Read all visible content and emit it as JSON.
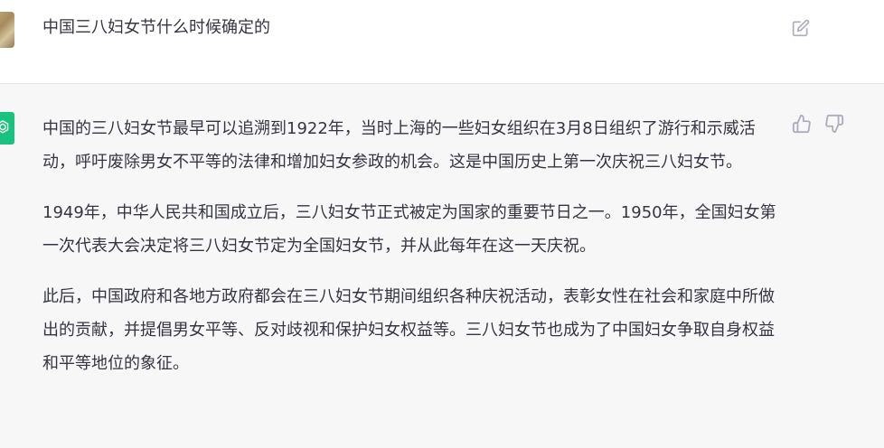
{
  "user_message": {
    "text": "中国三八妇女节什么时候确定的",
    "avatar_icon": "user-photo",
    "edit_icon": "edit-icon"
  },
  "assistant_message": {
    "avatar_icon": "openai-logo",
    "avatar_color": "#19c37d",
    "paragraphs": [
      "中国的三八妇女节最早可以追溯到1922年，当时上海的一些妇女组织在3月8日组织了游行和示威活动，呼吁废除男女不平等的法律和增加妇女参政的机会。这是中国历史上第一次庆祝三八妇女节。",
      "1949年，中华人民共和国成立后，三八妇女节正式被定为国家的重要节日之一。1950年，全国妇女第一次代表大会决定将三八妇女节定为全国妇女节，并从此每年在这一天庆祝。",
      "此后，中国政府和各地方政府都会在三八妇女节期间组织各种庆祝活动，表彰女性在社会和家庭中所做出的贡献，并提倡男女平等、反对歧视和保护妇女权益等。三八妇女节也成为了中国妇女争取自身权益和平等地位的象征。"
    ],
    "feedback_icons": [
      "thumbs-up-icon",
      "thumbs-down-icon"
    ]
  },
  "colors": {
    "user_bg": "#ffffff",
    "assistant_bg": "#f7f7f8",
    "text": "#343541",
    "icon": "#acacbe"
  }
}
